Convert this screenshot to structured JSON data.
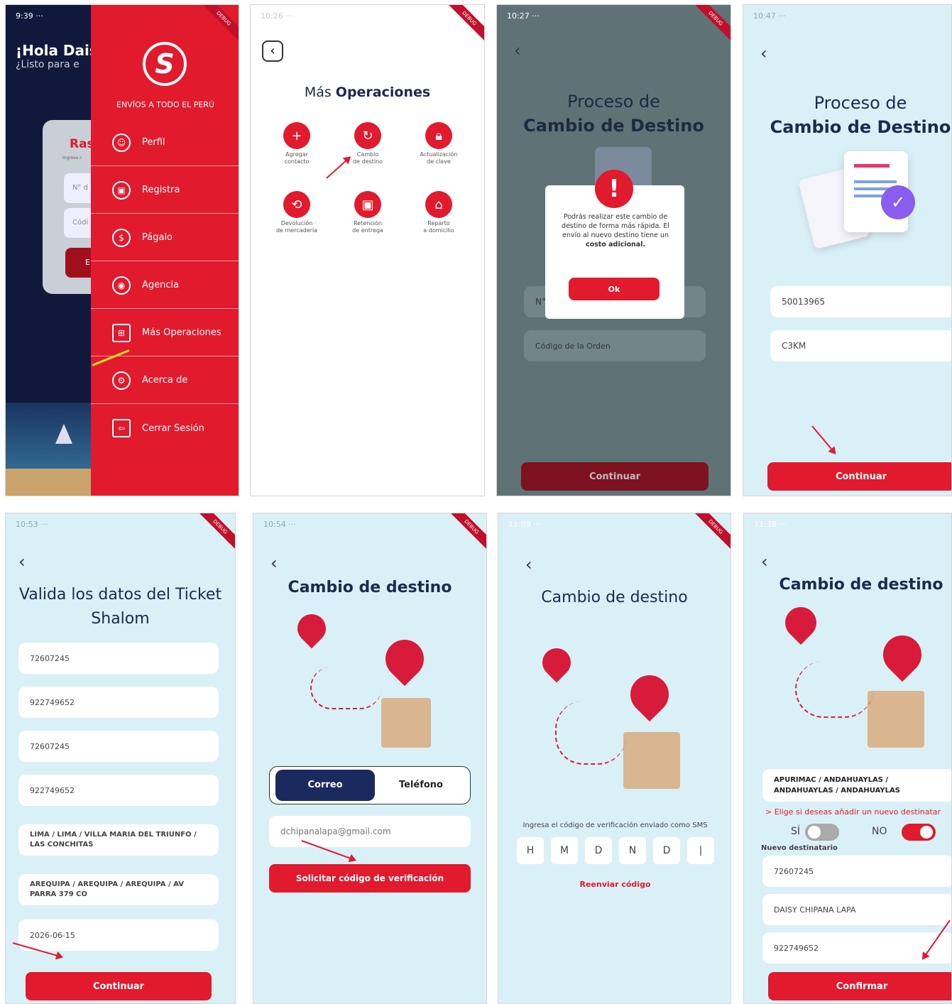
{
  "colors": {
    "red": "#e11a2e",
    "navy": "#1b2a4e",
    "light_bg": "#daf0f7",
    "gray_dark": "#5f7377"
  },
  "s1": {
    "time": "9:39",
    "greeting": "¡Hola Dais",
    "sub": "¿Listo para e",
    "card_title": "Ras",
    "card_sub": "Ingrese c",
    "f1": "N° d",
    "f2": "Códi",
    "btn": "E",
    "brand": "ENVÍOS A TODO EL PERÚ",
    "menu": [
      {
        "label": "Perfil",
        "icon": "user-icon"
      },
      {
        "label": "Registra",
        "icon": "box-icon"
      },
      {
        "label": "Págalo",
        "icon": "payment-icon"
      },
      {
        "label": "Agencia",
        "icon": "location-icon"
      },
      {
        "label": "Más Operaciones",
        "icon": "grid-plus-icon"
      },
      {
        "label": "Acerca de",
        "icon": "gear-icon"
      },
      {
        "label": "Cerrar Sesión",
        "icon": "logout-icon"
      }
    ]
  },
  "s2": {
    "time": "10:26",
    "title_a": "Más ",
    "title_b": "Operaciones",
    "ops": [
      {
        "l1": "Agregar",
        "l2": "contacto"
      },
      {
        "l1": "Cambio",
        "l2": "de destino"
      },
      {
        "l1": "Actualización",
        "l2": "de clave"
      },
      {
        "l1": "Devolución",
        "l2": "de mercadería"
      },
      {
        "l1": "Retención",
        "l2": "de entrega"
      },
      {
        "l1": "Reparto",
        "l2": "a domicilio"
      }
    ]
  },
  "s3": {
    "time": "10:27",
    "title1": "Proceso de",
    "title2": "Cambio de Destino",
    "dialog": "Podrás realizar este cambio de destino de forma más rápida. El envío al nuevo destino tiene un ",
    "dialog_bold": "costo adicional.",
    "ok": "Ok",
    "f1": "N°",
    "f2": "Código de la Orden",
    "btn": "Continuar"
  },
  "s4": {
    "time": "10:47",
    "title1": "Proceso de",
    "title2": "Cambio de Destino",
    "f1": "50013965",
    "f2": "C3KM",
    "btn": "Continuar"
  },
  "s5": {
    "time": "10:53",
    "title": "Valida los datos del Ticket Shalom",
    "fields": [
      "72607245",
      "922749652",
      "72607245",
      "922749652",
      "LIMA / LIMA / VILLA MARIA DEL TRIUNFO / LAS CONCHITAS",
      "AREQUIPA / AREQUIPA / AREQUIPA / AV PARRA 379 CO",
      "2026-06-15"
    ],
    "btn": "Continuar"
  },
  "s6": {
    "time": "10:54",
    "title": "Cambio de destino",
    "tab1": "Correo",
    "tab2": "Teléfono",
    "email": "dchipanalapa@gmail.com",
    "btn": "Solicitar código de verificación"
  },
  "s7": {
    "time": "11:09",
    "title": "Cambio de destino",
    "hint": "Ingresa el código de verificación enviado como SMS",
    "code": [
      "H",
      "M",
      "D",
      "N",
      "D",
      "|"
    ],
    "resend": "Reenviar código"
  },
  "s8": {
    "time": "11:38",
    "title": "Cambio de destino",
    "dest": "APURIMAC / ANDAHUAYLAS / ANDAHUAYLAS / ANDAHUAYLAS",
    "choose": "> Elige si deseas añadir un nuevo destinatar",
    "si": "SÍ",
    "no": "NO",
    "new_label": "Nuevo destinatario",
    "f1": "72607245",
    "f2": "DAISY CHIPANA LAPA",
    "f3": "922749652",
    "btn": "Confirmar"
  },
  "debug": "DEBUG"
}
